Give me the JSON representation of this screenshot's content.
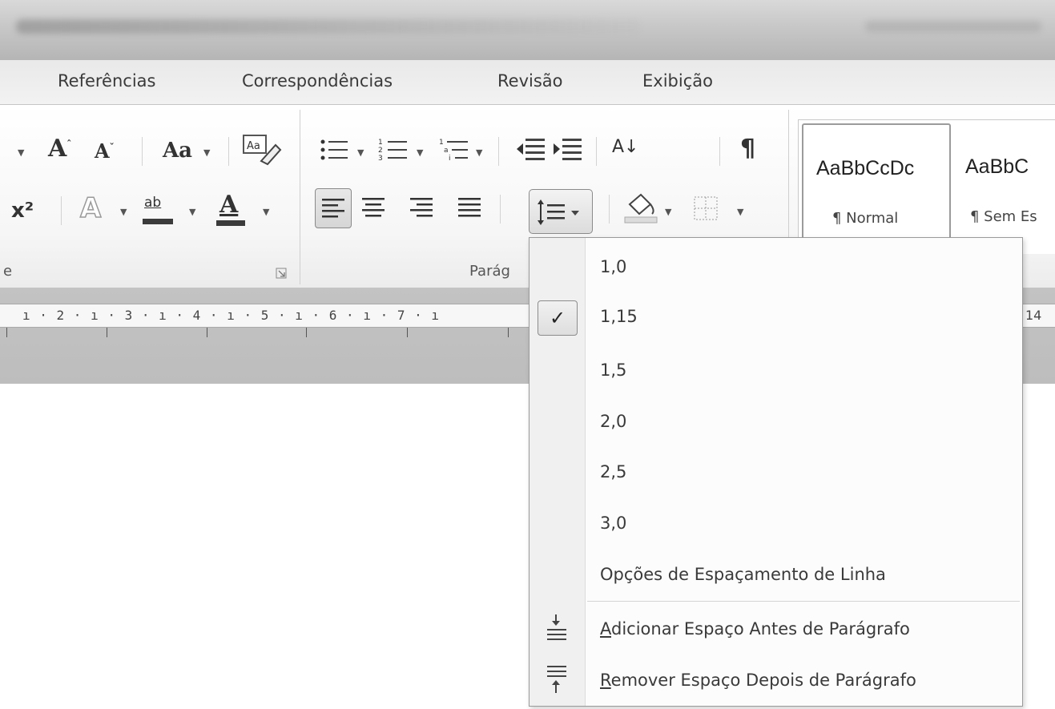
{
  "tabs": [
    "Referências",
    "Correspondências",
    "Revisão",
    "Exibição"
  ],
  "ribbon": {
    "font_group_label": "e",
    "paragraph_group_label": "Parág",
    "icons": {
      "grow_font": "A",
      "shrink_font": "A",
      "change_case": "Aa",
      "clear_format": "clear-formatting-icon",
      "superscript": "x²",
      "text_effects": "A",
      "highlight": "ab",
      "font_color": "A",
      "sort": "A↓",
      "pilcrow": "¶"
    }
  },
  "styles": [
    {
      "sample": "AaBbCcDc",
      "name": "¶ Normal"
    },
    {
      "sample": "AaBbC",
      "name": "¶ Sem Es"
    }
  ],
  "ruler": {
    "numbers": "ı · 2 · ı · 3 · ı · 4 · ı · 5 · ı · 6 · ı · 7 · ı",
    "end": "14"
  },
  "menu": {
    "spacing_options": [
      "1,0",
      "1,15",
      "1,5",
      "2,0",
      "2,5",
      "3,0"
    ],
    "checked": "1,15",
    "checkmark": "✓",
    "options_label": "Opções de Espaçamento de Linha",
    "add_before": {
      "accel": "A",
      "rest": "dicionar Espaço Antes de Parágrafo"
    },
    "remove_after": {
      "accel": "R",
      "rest": "emover Espaço Depois de Parágrafo"
    }
  }
}
